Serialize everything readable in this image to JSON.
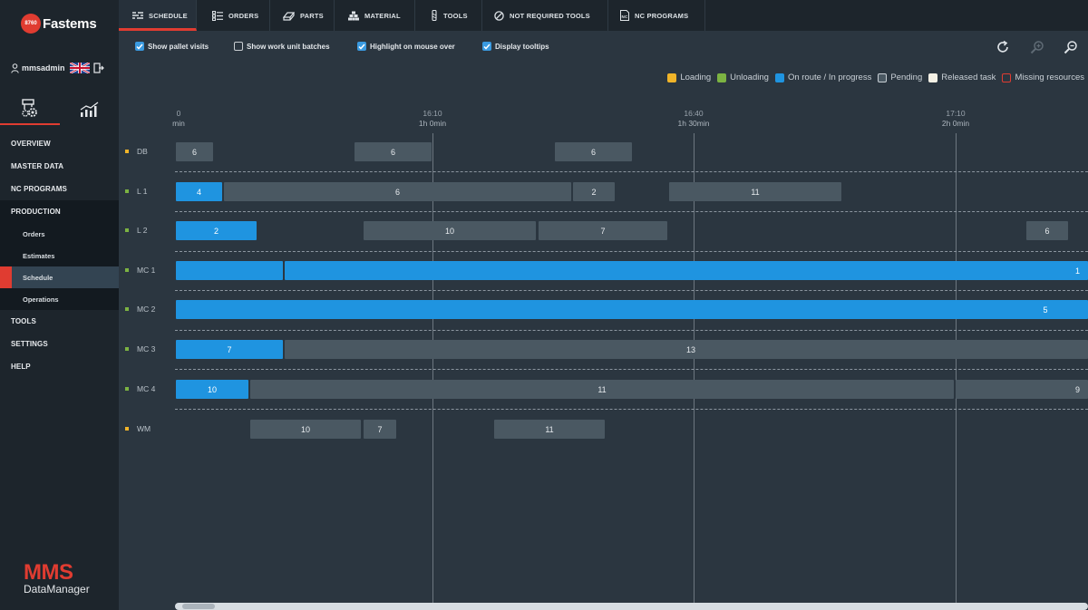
{
  "brand": {
    "badge": "8760",
    "name": "Fastems"
  },
  "user": {
    "name": "mmsadmin"
  },
  "nav": {
    "overview": "OVERVIEW",
    "master_data": "MASTER DATA",
    "nc_programs": "NC PROGRAMS",
    "production": "PRODUCTION",
    "orders": "Orders",
    "estimates": "Estimates",
    "schedule": "Schedule",
    "operations": "Operations",
    "tools": "TOOLS",
    "settings": "SETTINGS",
    "help": "HELP"
  },
  "footer": {
    "title": "MMS",
    "subtitle": "DataManager"
  },
  "tabs": {
    "schedule": "SCHEDULE",
    "orders": "ORDERS",
    "parts": "PARTS",
    "material": "MATERIAL",
    "tools": "TOOLS",
    "not_required_tools": "NOT REQUIRED TOOLS",
    "nc_programs": "NC PROGRAMS"
  },
  "options": {
    "show_pallet_visits": {
      "label": "Show pallet visits",
      "checked": true
    },
    "show_work_unit_batches": {
      "label": "Show work unit batches",
      "checked": false
    },
    "highlight_on_mouse_over": {
      "label": "Highlight on mouse over",
      "checked": true
    },
    "display_tooltips": {
      "label": "Display tooltips",
      "checked": true
    }
  },
  "legend": {
    "loading": {
      "label": "Loading",
      "color": "#f0b429"
    },
    "unloading": {
      "label": "Unloading",
      "color": "#7cb342"
    },
    "on_route": {
      "label": "On route / In progress",
      "color": "#1f94e0"
    },
    "pending": {
      "label": "Pending",
      "color": "#4a5862"
    },
    "released": {
      "label": "Released task",
      "color": "#f4f1e6"
    },
    "missing": {
      "label": "Missing resources",
      "color": "#e03c31"
    }
  },
  "axis": {
    "t0": {
      "time": "0",
      "dur": "min"
    },
    "t1": {
      "time": "16:10",
      "dur": "1h 0min"
    },
    "t2": {
      "time": "16:40",
      "dur": "1h 30min"
    },
    "t3": {
      "time": "17:10",
      "dur": "2h 0min"
    }
  },
  "rows": {
    "db": {
      "label": "DB",
      "tasks": [
        "6",
        "6",
        "6"
      ]
    },
    "l1": {
      "label": "L 1",
      "tasks": [
        "4",
        "6",
        "2",
        "11"
      ]
    },
    "l2": {
      "label": "L 2",
      "tasks": [
        "2",
        "10",
        "7",
        "6"
      ]
    },
    "mc1": {
      "label": "MC 1",
      "tasks": [
        "",
        "1"
      ]
    },
    "mc2": {
      "label": "MC 2",
      "tasks": [
        "5"
      ]
    },
    "mc3": {
      "label": "MC 3",
      "tasks": [
        "7",
        "13"
      ]
    },
    "mc4": {
      "label": "MC 4",
      "tasks": [
        "10",
        "11",
        "9"
      ]
    },
    "wm": {
      "label": "WM",
      "tasks": [
        "10",
        "7",
        "11"
      ]
    }
  }
}
